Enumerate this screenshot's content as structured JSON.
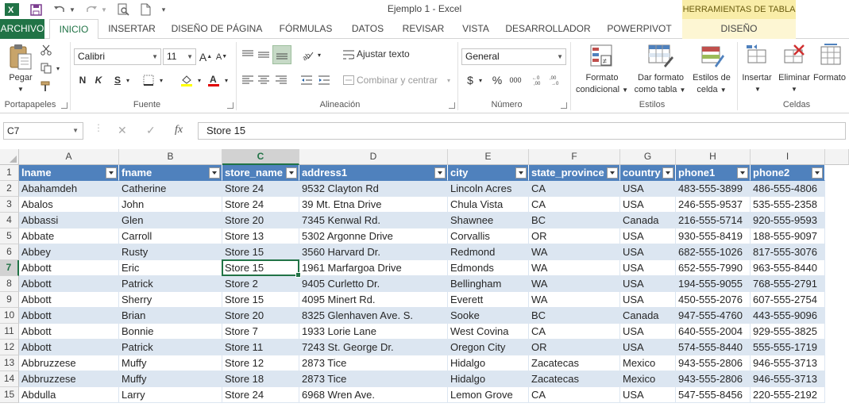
{
  "window": {
    "title": "Ejemplo 1 - Excel",
    "contextual_header": "HERRAMIENTAS DE TABLA"
  },
  "ribbon_tabs": [
    "ARCHIVO",
    "INICIO",
    "INSERTAR",
    "DISEÑO DE PÁGINA",
    "FÓRMULAS",
    "DATOS",
    "REVISAR",
    "VISTA",
    "DESARROLLADOR",
    "POWERPIVOT",
    "DISEÑO"
  ],
  "active_tab": "INICIO",
  "ribbon": {
    "clipboard": {
      "paste_label": "Pegar",
      "group_label": "Portapapeles"
    },
    "font": {
      "font_name": "Calibri",
      "font_size": "11",
      "grow": "A",
      "shrink": "A",
      "bold": "N",
      "italic": "K",
      "underline": "S",
      "group_label": "Fuente"
    },
    "alignment": {
      "wrap_text": "Ajustar texto",
      "merge_center": "Combinar y centrar",
      "group_label": "Alineación"
    },
    "number": {
      "format": "General",
      "currency": "$",
      "percent": "%",
      "thousands": "000",
      "group_label": "Número"
    },
    "styles": {
      "conditional_1": "Formato",
      "conditional_2": "condicional",
      "format_table_1": "Dar formato",
      "format_table_2": "como tabla",
      "cell_styles_1": "Estilos de",
      "cell_styles_2": "celda",
      "group_label": "Estilos"
    },
    "cells": {
      "insert": "Insertar",
      "delete": "Eliminar",
      "format": "Formato",
      "group_label": "Celdas"
    }
  },
  "formula_bar": {
    "name_box": "C7",
    "fx": "fx",
    "cancel": "✕",
    "enter": "✓",
    "value": "Store 15"
  },
  "colors": {
    "excel_green": "#217346",
    "table_header": "#4f81bd",
    "table_band": "#dce6f1"
  },
  "grid": {
    "column_letters": [
      "A",
      "B",
      "C",
      "D",
      "E",
      "F",
      "G",
      "H",
      "I"
    ],
    "selected_column": "C",
    "selected_row": "7",
    "row_numbers": [
      "1",
      "2",
      "3",
      "4",
      "5",
      "6",
      "7",
      "8",
      "9",
      "10",
      "11",
      "12",
      "13",
      "14",
      "15"
    ],
    "headers": [
      "lname",
      "fname",
      "store_name",
      "address1",
      "city",
      "state_province",
      "country",
      "phone1",
      "phone2"
    ],
    "rows": [
      [
        "Abahamdeh",
        "Catherine",
        "Store 24",
        "9532 Clayton Rd",
        "Lincoln Acres",
        "CA",
        "USA",
        "483-555-3899",
        "486-555-4806"
      ],
      [
        "Abalos",
        "John",
        "Store 24",
        "39 Mt. Etna Drive",
        "Chula Vista",
        "CA",
        "USA",
        "246-555-9537",
        "535-555-2358"
      ],
      [
        "Abbassi",
        "Glen",
        "Store 20",
        "7345 Kenwal Rd.",
        "Shawnee",
        "BC",
        "Canada",
        "216-555-5714",
        "920-555-9593"
      ],
      [
        "Abbate",
        "Carroll",
        "Store 13",
        "5302 Argonne Drive",
        "Corvallis",
        "OR",
        "USA",
        "930-555-8419",
        "188-555-9097"
      ],
      [
        "Abbey",
        "Rusty",
        "Store 15",
        "3560 Harvard Dr.",
        "Redmond",
        "WA",
        "USA",
        "682-555-1026",
        "817-555-3076"
      ],
      [
        "Abbott",
        "Eric",
        "Store 15",
        "1961 Marfargoa Drive",
        "Edmonds",
        "WA",
        "USA",
        "652-555-7990",
        "963-555-8440"
      ],
      [
        "Abbott",
        "Patrick",
        "Store 2",
        "9405 Curletto Dr.",
        "Bellingham",
        "WA",
        "USA",
        "194-555-9055",
        "768-555-2791"
      ],
      [
        "Abbott",
        "Sherry",
        "Store 15",
        "4095 Minert Rd.",
        "Everett",
        "WA",
        "USA",
        "450-555-2076",
        "607-555-2754"
      ],
      [
        "Abbott",
        "Brian",
        "Store 20",
        "8325 Glenhaven Ave. S.",
        "Sooke",
        "BC",
        "Canada",
        "947-555-4760",
        "443-555-9096"
      ],
      [
        "Abbott",
        "Bonnie",
        "Store 7",
        "1933 Lorie Lane",
        "West Covina",
        "CA",
        "USA",
        "640-555-2004",
        "929-555-3825"
      ],
      [
        "Abbott",
        "Patrick",
        "Store 11",
        "7243 St. George Dr.",
        "Oregon City",
        "OR",
        "USA",
        "574-555-8440",
        "555-555-1719"
      ],
      [
        "Abbruzzese",
        "Muffy",
        "Store 12",
        "2873 Tice",
        "Hidalgo",
        "Zacatecas",
        "Mexico",
        "943-555-2806",
        "946-555-3713"
      ],
      [
        "Abbruzzese",
        "Muffy",
        "Store 18",
        "2873 Tice",
        "Hidalgo",
        "Zacatecas",
        "Mexico",
        "943-555-2806",
        "946-555-3713"
      ],
      [
        "Abdulla",
        "Larry",
        "Store 24",
        "6968 Wren Ave.",
        "Lemon Grove",
        "CA",
        "USA",
        "547-555-8456",
        "220-555-2192"
      ]
    ]
  }
}
